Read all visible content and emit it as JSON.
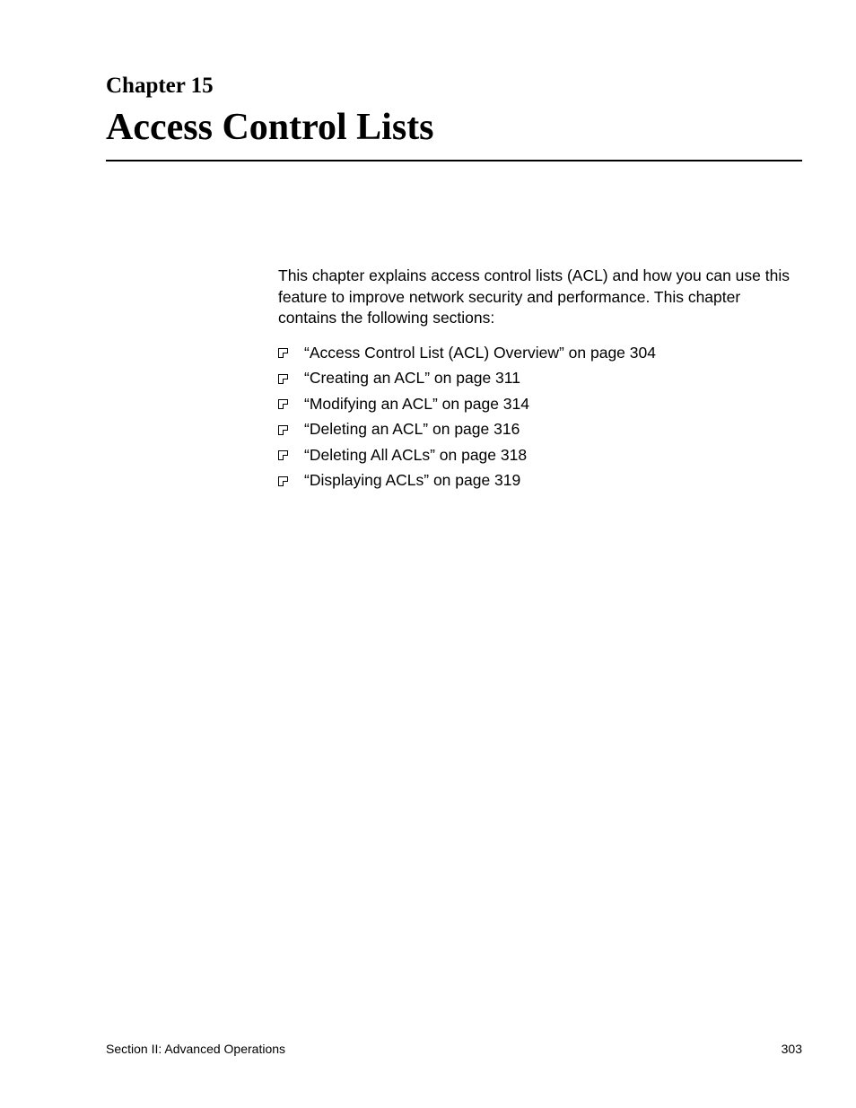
{
  "header": {
    "chapter_label": "Chapter 15",
    "chapter_title": "Access Control Lists"
  },
  "body": {
    "intro": "This chapter explains access control lists (ACL) and how you can use this feature to improve network security and performance. This chapter contains the following sections:",
    "toc_items": [
      "“Access Control List (ACL) Overview” on page 304",
      "“Creating an ACL” on page 311",
      "“Modifying an ACL” on page 314",
      "“Deleting an ACL” on page 316",
      "“Deleting All ACLs” on page 318",
      "“Displaying ACLs” on page 319"
    ]
  },
  "footer": {
    "section_label": "Section II: Advanced Operations",
    "page_number": "303"
  }
}
